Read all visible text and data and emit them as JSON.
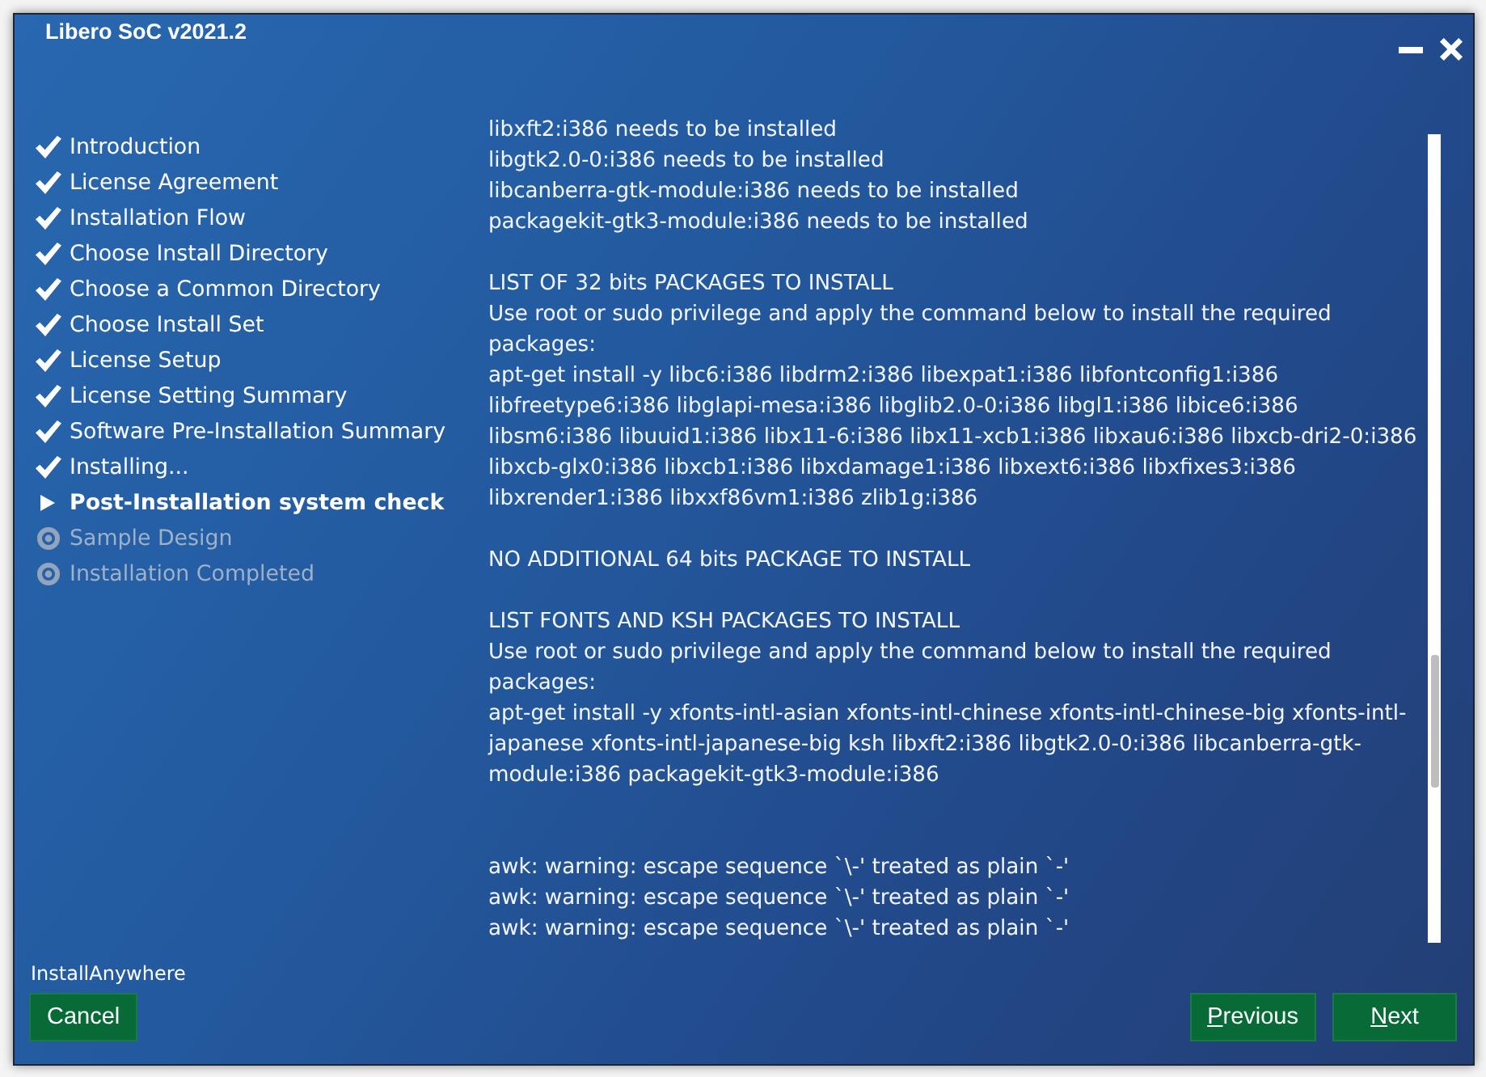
{
  "window": {
    "title": "Libero SoC v2021.2"
  },
  "steps": [
    {
      "label": "Introduction",
      "completed": true,
      "selected": false
    },
    {
      "label": "License Agreement",
      "completed": true,
      "selected": false
    },
    {
      "label": "Installation Flow",
      "completed": true,
      "selected": false
    },
    {
      "label": "Choose Install Directory",
      "completed": true,
      "selected": false
    },
    {
      "label": "Choose a Common Directory",
      "completed": true,
      "selected": false
    },
    {
      "label": "Choose Install Set",
      "completed": true,
      "selected": false
    },
    {
      "label": "License Setup",
      "completed": true,
      "selected": false
    },
    {
      "label": "License Setting Summary",
      "completed": true,
      "selected": false
    },
    {
      "label": "Software Pre-Installation Summary",
      "completed": true,
      "selected": false
    },
    {
      "label": "Installing...",
      "completed": true,
      "selected": false
    },
    {
      "label": "Post-Installation system check",
      "completed": false,
      "selected": true
    },
    {
      "label": "Sample Design",
      "completed": false,
      "selected": false
    },
    {
      "label": "Installation Completed",
      "completed": false,
      "selected": false
    }
  ],
  "log": {
    "blocks": [
      {
        "lines": [
          "libxft2:i386 needs to be installed",
          "libgtk2.0-0:i386 needs to be installed",
          "libcanberra-gtk-module:i386 needs to be installed",
          "packagekit-gtk3-module:i386 needs to be installed"
        ]
      },
      {
        "lines": [
          "LIST OF 32 bits PACKAGES TO INSTALL",
          "Use root or sudo privilege and apply the command below to install the required packages:",
          "apt-get install -y libc6:i386 libdrm2:i386 libexpat1:i386 libfontconfig1:i386 libfreetype6:i386 libglapi-mesa:i386 libglib2.0-0:i386 libgl1:i386 libice6:i386 libsm6:i386 libuuid1:i386 libx11-6:i386 libx11-xcb1:i386 libxau6:i386 libxcb-dri2-0:i386 libxcb-glx0:i386 libxcb1:i386 libxdamage1:i386 libxext6:i386 libxfixes3:i386 libxrender1:i386 libxxf86vm1:i386 zlib1g:i386"
        ]
      },
      {
        "lines": [
          "NO ADDITIONAL 64 bits PACKAGE TO INSTALL"
        ]
      },
      {
        "lines": [
          "LIST FONTS AND KSH PACKAGES TO INSTALL",
          "Use root or sudo privilege and apply the command below to install the required packages:",
          "apt-get install -y xfonts-intl-asian xfonts-intl-chinese xfonts-intl-chinese-big xfonts-intl-japanese xfonts-intl-japanese-big ksh libxft2:i386 libgtk2.0-0:i386 libcanberra-gtk-module:i386 packagekit-gtk3-module:i386"
        ]
      },
      {
        "lines": [
          "awk: warning: escape sequence `\\-' treated as plain `-'",
          "awk: warning: escape sequence `\\-' treated as plain `-'",
          "awk: warning: escape sequence `\\-' treated as plain `-'"
        ]
      }
    ]
  },
  "footer": {
    "brand": "InstallAnywhere"
  },
  "buttons": [
    {
      "label": "Cancel",
      "mnemonic": false
    },
    {
      "label": "Previous",
      "mnemonic": true
    },
    {
      "label": "Next",
      "mnemonic": true
    }
  ]
}
